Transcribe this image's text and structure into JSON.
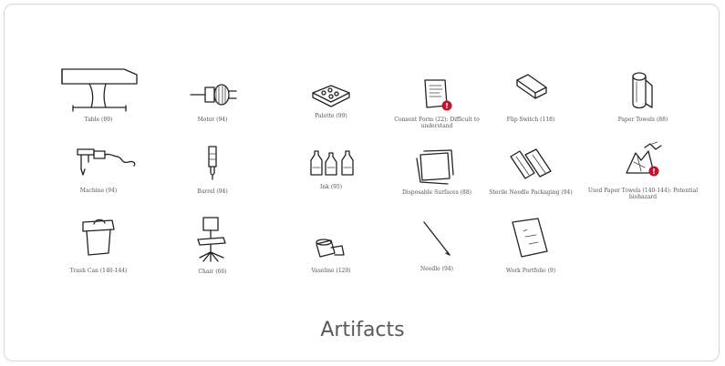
{
  "figure": {
    "caption": "Artifacts",
    "items": [
      {
        "label": "Table (89)",
        "icon": "table-icon"
      },
      {
        "label": "Motor (94)",
        "icon": "motor-icon"
      },
      {
        "label": "Palette (99)",
        "icon": "palette-icon"
      },
      {
        "label": "Consent Form (22): Difficult to understand",
        "icon": "consent-form-icon",
        "warning": true
      },
      {
        "label": "Flip Switch (118)",
        "icon": "flip-switch-icon"
      },
      {
        "label": "Paper Towels (88)",
        "icon": "paper-towels-icon"
      },
      {
        "label": "Machine (94)",
        "icon": "machine-icon"
      },
      {
        "label": "Barrel (94)",
        "icon": "barrel-icon"
      },
      {
        "label": "Ink (95)",
        "icon": "ink-icon"
      },
      {
        "label": "Disposable Surfaces (88)",
        "icon": "disposable-surfaces-icon"
      },
      {
        "label": "Sterile Needle Packaging (94)",
        "icon": "sterile-needle-packaging-icon"
      },
      {
        "label": "Used Paper Towels (140-144): Potential biohazard",
        "icon": "used-paper-towels-icon",
        "warning": true
      },
      {
        "label": "Trash Can (140-144)",
        "icon": "trash-can-icon"
      },
      {
        "label": "Chair (66)",
        "icon": "chair-icon"
      },
      {
        "label": "Vaseline (120)",
        "icon": "vaseline-icon"
      },
      {
        "label": "Needle (94)",
        "icon": "needle-icon"
      },
      {
        "label": "Work Portfolio (9)",
        "icon": "work-portfolio-icon"
      }
    ],
    "colors": {
      "warning": "#c8102e",
      "caption": "#5a5a5a",
      "border": "#d6d6d6"
    }
  }
}
